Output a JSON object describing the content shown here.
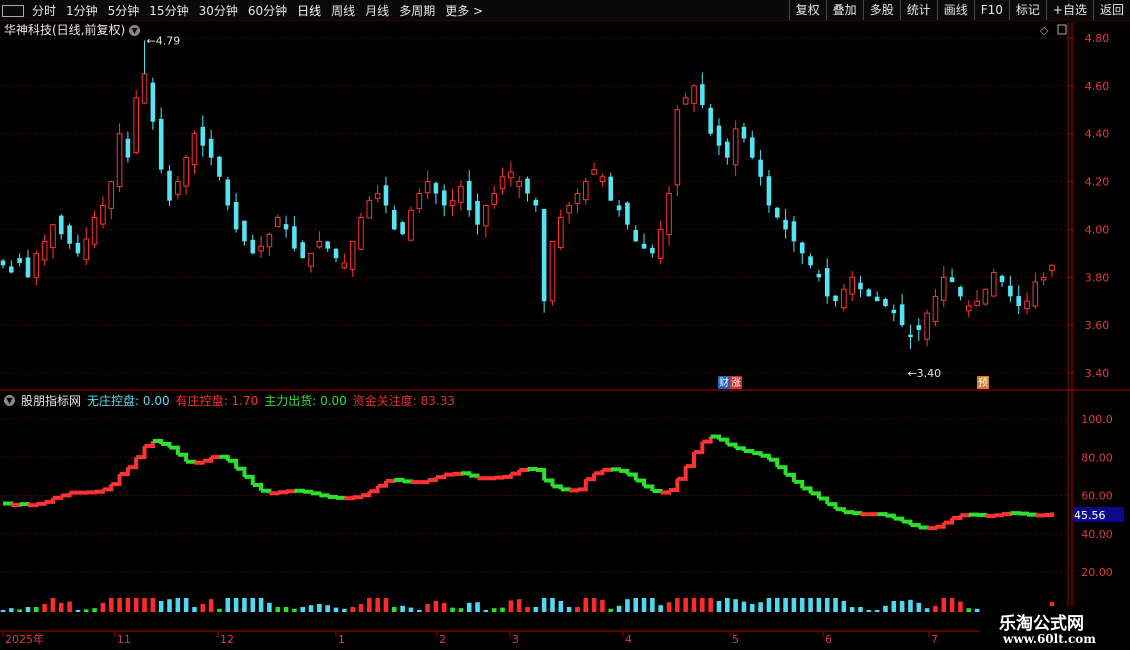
{
  "toolbar": {
    "periods": [
      "分时",
      "1分钟",
      "5分钟",
      "15分钟",
      "30分钟",
      "60分钟",
      "日线",
      "周线",
      "月线",
      "多周期",
      "更多 >"
    ],
    "active_period": "日线",
    "actions": [
      "复权",
      "叠加",
      "多股",
      "统计",
      "画线",
      "F10",
      "标记",
      "+自选",
      "返回"
    ]
  },
  "stock": {
    "title": "华神科技(日线,前复权)"
  },
  "price_panel": {
    "y_labels": [
      "4.80",
      "4.60",
      "4.40",
      "4.20",
      "4.00",
      "3.80",
      "3.60",
      "3.40"
    ],
    "high_label": "4.79",
    "low_label": "3.40",
    "badges": [
      {
        "text": "财",
        "color": "#1e5fb8"
      },
      {
        "text": "涨",
        "color": "#c83232"
      },
      {
        "text": "预",
        "color": "#d07a2a"
      }
    ]
  },
  "indicator": {
    "name": "股朋指标网",
    "items": [
      {
        "label": "无庄控盘:",
        "value": "0.00",
        "color": "#5ad7f0"
      },
      {
        "label": "有庄控盘:",
        "value": "1.70",
        "color": "#ff3030"
      },
      {
        "label": "主力出货:",
        "value": "0.00",
        "color": "#30e030"
      },
      {
        "label": "资金关注度:",
        "value": "83.33",
        "color": "#e03030"
      }
    ],
    "y_labels": [
      "100.0",
      "80.00",
      "60.00",
      "40.00",
      "20.00"
    ],
    "cursor_value": "45.56"
  },
  "x_axis": [
    "2025年",
    "11",
    "12",
    "1",
    "2",
    "3",
    "4",
    "5",
    "6",
    "7"
  ],
  "watermark": {
    "line1": "乐淘公式网",
    "line2": "www.60lt.com"
  },
  "colors": {
    "up": "#ff3333",
    "down": "#54e4f4",
    "grid": "#5a0000",
    "axis": "#b00000"
  },
  "chart_data": {
    "type": "candlestick",
    "price_range": [
      3.4,
      4.8
    ],
    "high": 4.79,
    "low": 3.4,
    "indicator_range": [
      20,
      100
    ],
    "close_path": [
      3.85,
      3.82,
      3.86,
      3.8,
      3.9,
      3.95,
      4.02,
      3.98,
      3.94,
      3.9,
      3.96,
      4.05,
      4.1,
      4.2,
      4.4,
      4.3,
      4.55,
      4.65,
      4.45,
      4.25,
      4.12,
      4.2,
      4.3,
      4.4,
      4.35,
      4.3,
      4.22,
      4.1,
      4.0,
      3.95,
      3.9,
      3.93,
      3.98,
      4.05,
      4.0,
      3.92,
      3.88,
      3.9,
      3.95,
      3.92,
      3.88,
      3.86,
      3.95,
      4.05,
      4.12,
      4.15,
      4.1,
      4.0,
      3.98,
      4.08,
      4.15,
      4.2,
      4.15,
      4.1,
      4.12,
      4.18,
      4.08,
      4.02,
      4.1,
      4.15,
      4.22,
      4.24,
      4.2,
      4.15,
      4.1,
      3.7,
      3.95,
      4.05,
      4.1,
      4.15,
      4.2,
      4.25,
      4.22,
      4.12,
      4.08,
      4.02,
      3.95,
      3.92,
      3.9,
      4.0,
      4.15,
      4.5,
      4.55,
      4.6,
      4.52,
      4.4,
      4.35,
      4.3,
      4.42,
      4.38,
      4.3,
      4.22,
      4.1,
      4.05,
      4.0,
      3.95,
      3.9,
      3.85,
      3.8,
      3.72,
      3.7,
      3.75,
      3.8,
      3.75,
      3.72,
      3.7,
      3.68,
      3.65,
      3.6,
      3.55,
      3.58,
      3.65,
      3.72,
      3.8,
      3.78,
      3.72,
      3.68,
      3.7,
      3.75,
      3.82,
      3.78,
      3.72,
      3.68,
      3.7,
      3.78,
      3.8,
      3.85
    ]
  }
}
